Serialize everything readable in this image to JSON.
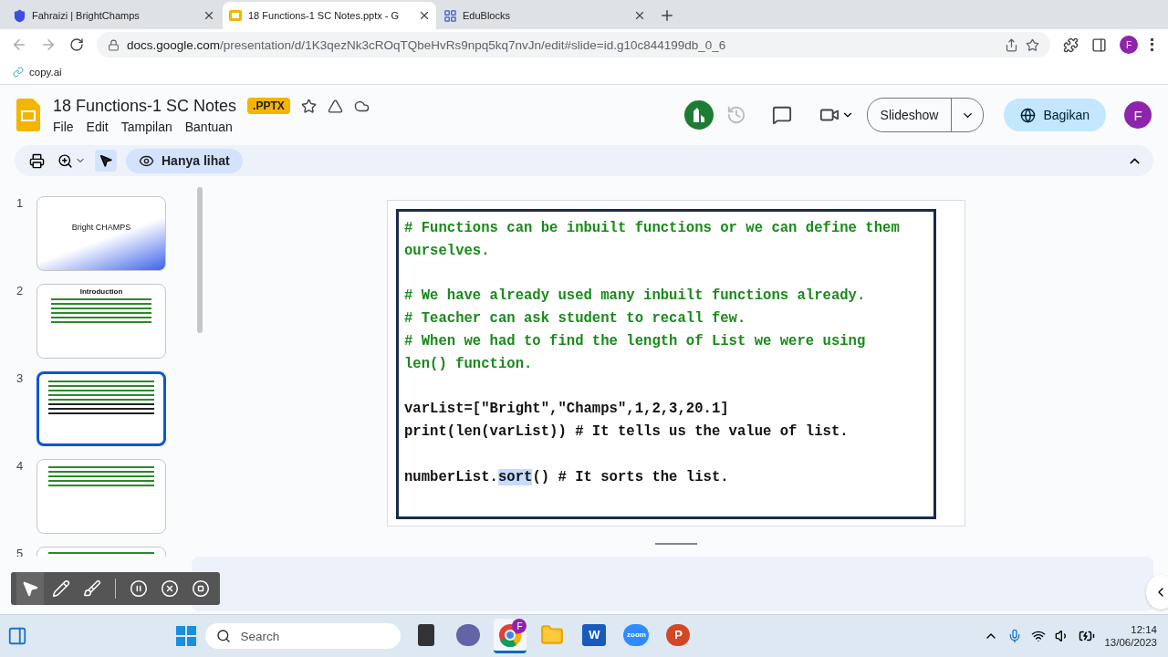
{
  "browser": {
    "tabs": [
      {
        "title": "Fahraizi | BrightChamps",
        "kind": "shield",
        "selected": false
      },
      {
        "title": "18 Functions-1 SC Notes.pptx - G",
        "kind": "slides",
        "selected": true
      },
      {
        "title": "EduBlocks",
        "kind": "blocks",
        "selected": false
      }
    ],
    "url_host": "docs.google.com",
    "url_path": "/presentation/d/1K3qezNk3cROqTQbeHvRs9npq5kq7nvJn/edit#slide=id.g10c844199db_0_6",
    "profile": "F",
    "bookmarks": [
      {
        "label": "copy.ai"
      }
    ]
  },
  "document": {
    "title": "18 Functions-1 SC Notes",
    "badge": ".PPTX",
    "menu": [
      "File",
      "Edit",
      "Tampilan",
      "Bantuan"
    ],
    "slideshow": "Slideshow",
    "share": "Bagikan",
    "avatar": "F",
    "view_mode": "Hanya lihat"
  },
  "slides": [
    {
      "number": "1",
      "kind": "title",
      "title": "Bright CHAMPS",
      "selected": false
    },
    {
      "number": "2",
      "kind": "intro",
      "title": "Introduction",
      "selected": false
    },
    {
      "number": "3",
      "kind": "code",
      "selected": true
    },
    {
      "number": "4",
      "kind": "code_short",
      "selected": false
    },
    {
      "number": "5",
      "kind": "partial",
      "selected": false
    }
  ],
  "slide": {
    "lines": [
      {
        "kind": "comment",
        "parts": [
          {
            "text": "# Functions can be inbuilt functions or we can define them",
            "selected": false
          }
        ]
      },
      {
        "kind": "comment",
        "parts": [
          {
            "text": "ourselves.",
            "selected": false
          }
        ]
      },
      {
        "kind": "blank"
      },
      {
        "kind": "comment",
        "parts": [
          {
            "text": "# We have already used many inbuilt functions already.",
            "selected": false
          }
        ]
      },
      {
        "kind": "comment",
        "parts": [
          {
            "text": "# Teacher can ask student to recall few.",
            "selected": false
          }
        ]
      },
      {
        "kind": "comment",
        "parts": [
          {
            "text": "# When we had to find the length of List we were using",
            "selected": false
          }
        ]
      },
      {
        "kind": "comment",
        "parts": [
          {
            "text": "len() function.",
            "selected": false
          }
        ]
      },
      {
        "kind": "blank"
      },
      {
        "kind": "code",
        "parts": [
          {
            "text": "varList=[\"Bright\",\"Champs\",1,2,3,20.1]",
            "selected": false
          }
        ]
      },
      {
        "kind": "code",
        "parts": [
          {
            "text": "print(len(varList)) # It tells us the value of list.",
            "selected": false
          }
        ]
      },
      {
        "kind": "blank"
      },
      {
        "kind": "code",
        "parts": [
          {
            "text": "numberList.",
            "selected": false
          },
          {
            "text": "sort",
            "selected": true
          },
          {
            "text": "() # It sorts the list.",
            "selected": false
          }
        ]
      }
    ]
  },
  "annotation_toolbar": [
    {
      "kind": "pointer",
      "selected": true
    },
    {
      "kind": "pen",
      "selected": false
    },
    {
      "kind": "brush",
      "selected": false
    },
    {
      "kind": "pause",
      "selected": false
    },
    {
      "kind": "cancel",
      "selected": false
    },
    {
      "kind": "stop",
      "selected": false
    }
  ],
  "taskbar": {
    "search_placeholder": "Search",
    "apps": [
      {
        "kind": "files",
        "selected": false
      },
      {
        "kind": "meet",
        "selected": false
      },
      {
        "kind": "chrome",
        "selected": true
      },
      {
        "kind": "folder",
        "selected": false
      },
      {
        "kind": "word",
        "selected": false
      },
      {
        "kind": "zoom",
        "selected": false
      },
      {
        "kind": "powerpoint",
        "selected": false
      }
    ],
    "chrome_badge": "F",
    "word_letter": "W",
    "zoom_label": "zoom",
    "ppt_letter": "P",
    "time": "12:14",
    "date": "13/06/2023"
  }
}
